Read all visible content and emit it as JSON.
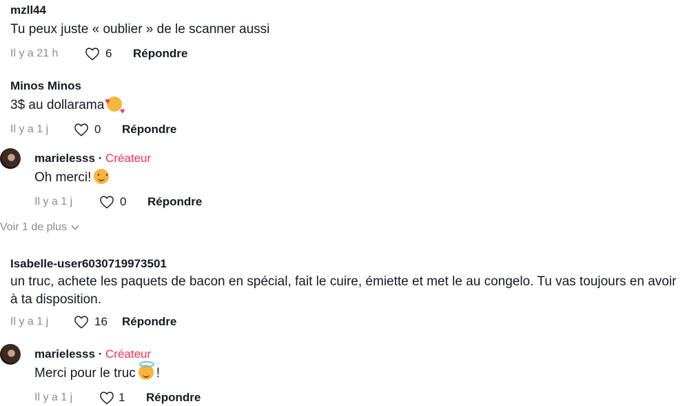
{
  "comments": [
    {
      "user": "mzll44",
      "text": "Tu peux juste « oublier » de le scanner aussi",
      "time": "Il y a 21 h",
      "likes": "6",
      "reply": "Répondre"
    },
    {
      "user": "Minos Minos",
      "text": "3$ au dollarama",
      "time": "Il y a 1 j",
      "likes": "0",
      "reply": "Répondre",
      "emoji": "smiling-face-with-hearts"
    },
    {
      "user": "marielesss",
      "creator_sep": " · ",
      "creator": "Créateur",
      "text": "Oh merci!",
      "time": "Il y a 1 j",
      "likes": "0",
      "reply": "Répondre",
      "emoji": "smiling-face"
    },
    {
      "user": "Isabelle-user6030719973501",
      "text": "un truc, achete les paquets de bacon en spécial, fait le cuire, émiette et met le au congelo. Tu vas toujours en avoir à ta disposition.",
      "time": "Il y a 1 j",
      "likes": "16",
      "reply": "Répondre"
    },
    {
      "user": "marielesss",
      "creator_sep": " · ",
      "creator": "Créateur",
      "text": "Merci pour le truc",
      "text_after": "!",
      "time": "Il y a 1 j",
      "likes": "1",
      "reply": "Répondre",
      "emoji": "smiling-face-with-halo"
    }
  ],
  "view_more": "Voir 1 de plus",
  "colors": {
    "creator": "#fe2c55",
    "meta": "#8a8b91",
    "text": "#161823"
  }
}
